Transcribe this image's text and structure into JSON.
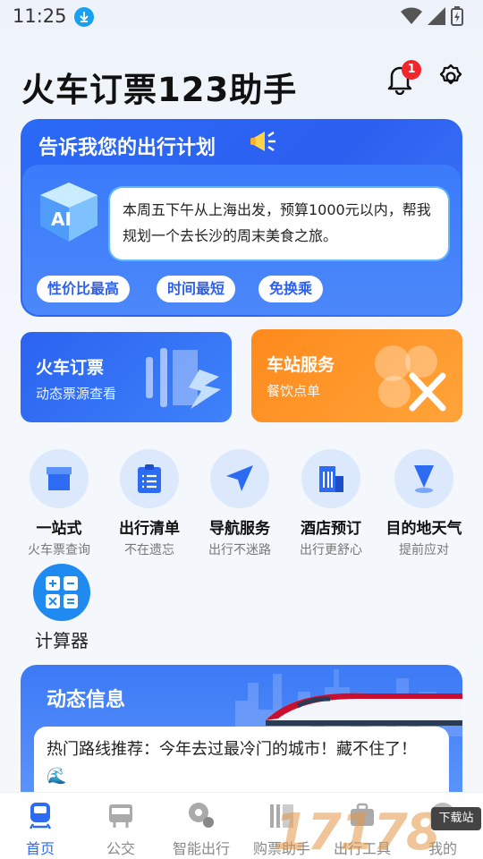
{
  "status_bar": {
    "time": "11:25"
  },
  "header": {
    "title": "火车订票123助手",
    "notification_count": "1"
  },
  "plan_card": {
    "title": "告诉我您的出行计划",
    "ai_label": "AI",
    "prompt": "本周五下午从上海出发，预算1000元以内，帮我规划一个去长沙的周末美食之旅。",
    "chips": [
      "性价比最高",
      "时间最短",
      "免换乘"
    ]
  },
  "features": {
    "train": {
      "title": "火车订票",
      "subtitle": "动态票源查看"
    },
    "station": {
      "title": "车站服务",
      "subtitle": "餐饮点单"
    }
  },
  "quick_grid": [
    {
      "label": "一站式",
      "sub": "火车票查询",
      "icon": "shop-icon"
    },
    {
      "label": "出行清单",
      "sub": "不在遗忘",
      "icon": "checklist-icon"
    },
    {
      "label": "导航服务",
      "sub": "出行不迷路",
      "icon": "navigation-icon"
    },
    {
      "label": "酒店预订",
      "sub": "出行更舒心",
      "icon": "hotel-icon"
    },
    {
      "label": "目的地天气",
      "sub": "提前应对",
      "icon": "location-pin-icon"
    }
  ],
  "calculator": {
    "label": "计算器"
  },
  "news": {
    "title": "动态信息",
    "item": "热门路线推荐：今年去过最冷门的城市！藏不住了！🌊"
  },
  "bottom_nav": [
    {
      "label": "首页",
      "active": true
    },
    {
      "label": "公交",
      "active": false
    },
    {
      "label": "智能出行",
      "active": false
    },
    {
      "label": "购票助手",
      "active": false
    },
    {
      "label": "出行工具",
      "active": false
    },
    {
      "label": "我的",
      "active": false
    }
  ],
  "watermark": {
    "text": "17178",
    "badge": "下载站"
  },
  "colors": {
    "primary": "#2d6bf2",
    "orange": "#ff8a1c",
    "badge_red": "#f0282d"
  }
}
